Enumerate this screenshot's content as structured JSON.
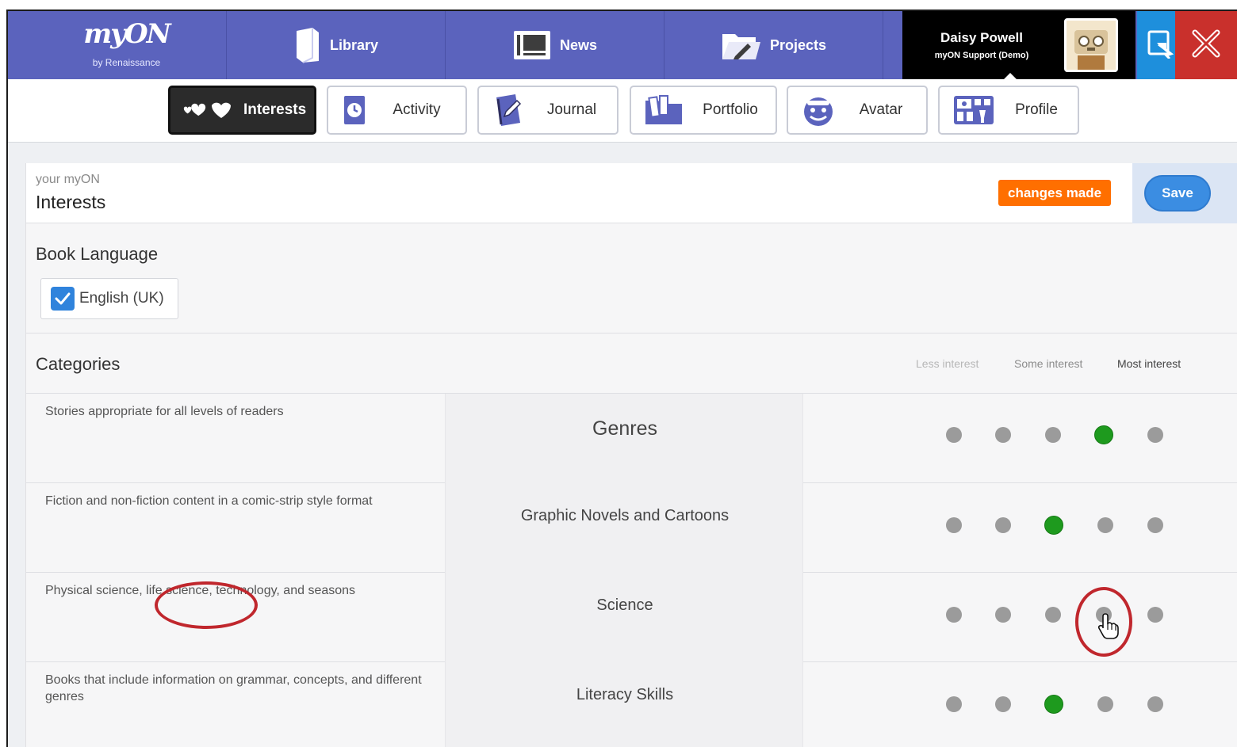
{
  "topnav": {
    "logo_main": "myON",
    "logo_sub": "by Renaissance",
    "items": [
      {
        "label": "Library",
        "icon": "book-icon"
      },
      {
        "label": "News",
        "icon": "newspaper-icon"
      },
      {
        "label": "Projects",
        "icon": "folder-pencil-icon"
      }
    ],
    "user": {
      "name": "Daisy Powell",
      "org": "myON Support (Demo)",
      "avatar_icon": "robot-avatar-icon"
    },
    "device_icon": "device-switch-icon",
    "close_icon": "close-x-icon"
  },
  "subnav": {
    "tabs": [
      {
        "label": "Interests",
        "icon": "hearts-icon",
        "active": true
      },
      {
        "label": "Activity",
        "icon": "clock-book-icon",
        "active": false
      },
      {
        "label": "Journal",
        "icon": "journal-pen-icon",
        "active": false
      },
      {
        "label": "Portfolio",
        "icon": "portfolio-folder-icon",
        "active": false
      },
      {
        "label": "Avatar",
        "icon": "smiley-face-icon",
        "active": false
      },
      {
        "label": "Profile",
        "icon": "profile-grid-icon",
        "active": false
      }
    ]
  },
  "header": {
    "kicker": "your myON",
    "title": "Interests",
    "status": "changes made",
    "save_label": "Save"
  },
  "language": {
    "title": "Book Language",
    "option": {
      "label": "English (UK)",
      "checked": true
    }
  },
  "categories": {
    "title": "Categories",
    "scale_labels": [
      "Less interest",
      "Some interest",
      "Most interest"
    ],
    "rows": [
      {
        "description": "Stories appropriate for all levels of readers",
        "name": "Genres",
        "selected_level": 4
      },
      {
        "description": "Fiction and non-fiction content in a comic-strip style format",
        "name": "Graphic Novels and Cartoons",
        "selected_level": 3
      },
      {
        "description": "Physical science, life science, technology, and seasons",
        "name": "Science",
        "selected_level": 0
      },
      {
        "description": "Books that include information on grammar, concepts, and different genres",
        "name": "Literacy Skills",
        "selected_level": 3
      }
    ]
  },
  "colors": {
    "nav": "#5b63bd",
    "selected": "#1e9a1e",
    "unselected": "#9b9b9b",
    "changes_badge": "#ff6f00",
    "save": "#3b8de2",
    "annotation": "#c0272d"
  }
}
